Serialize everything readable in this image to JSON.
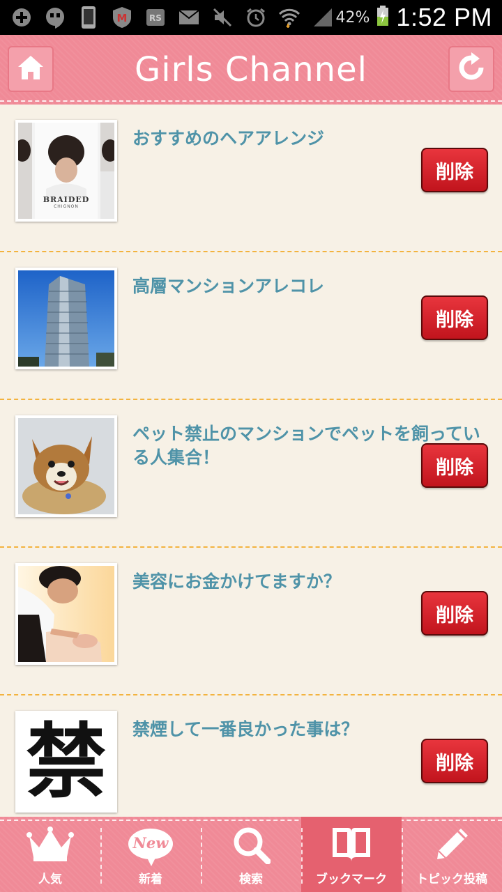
{
  "status_bar": {
    "battery": "42%",
    "time": "1:52 PM",
    "icons": [
      "plus-circle-icon",
      "hangouts-icon",
      "phone-icon",
      "mcafee-icon",
      "rss-icon",
      "mail-icon",
      "mute-icon",
      "alarm-icon",
      "wifi-icon",
      "signal-icon",
      "battery-charging-icon"
    ]
  },
  "header": {
    "title": "Girls Channel",
    "left_icon": "home-icon",
    "right_icon": "refresh-icon"
  },
  "delete_label": "削除",
  "items": [
    {
      "title": "おすすめのヘアアレンジ",
      "thumb_text_1": "BRAIDED",
      "thumb_text_2": "CHIGNON"
    },
    {
      "title": "高層マンションアレコレ"
    },
    {
      "title": "ペット禁止のマンションでペットを飼っている人集合！"
    },
    {
      "title": "美容にお金かけてますか？"
    },
    {
      "title": "禁煙して一番良かった事は？",
      "thumb_text_1": "禁"
    }
  ],
  "nav": [
    {
      "label": "人気",
      "icon": "crown-icon",
      "active": false
    },
    {
      "label": "新着",
      "icon": "new-badge-icon",
      "badge_text": "New",
      "active": false
    },
    {
      "label": "検索",
      "icon": "search-icon",
      "active": false
    },
    {
      "label": "ブックマーク",
      "icon": "book-icon",
      "active": true
    },
    {
      "label": "トピック投稿",
      "icon": "pencil-icon",
      "active": false
    }
  ],
  "colors": {
    "header_pink": "#f08a97",
    "title_teal": "#4f93a8",
    "delete_red": "#d42029",
    "divider_orange": "#f3b33f",
    "background": "#f7f1e6"
  }
}
